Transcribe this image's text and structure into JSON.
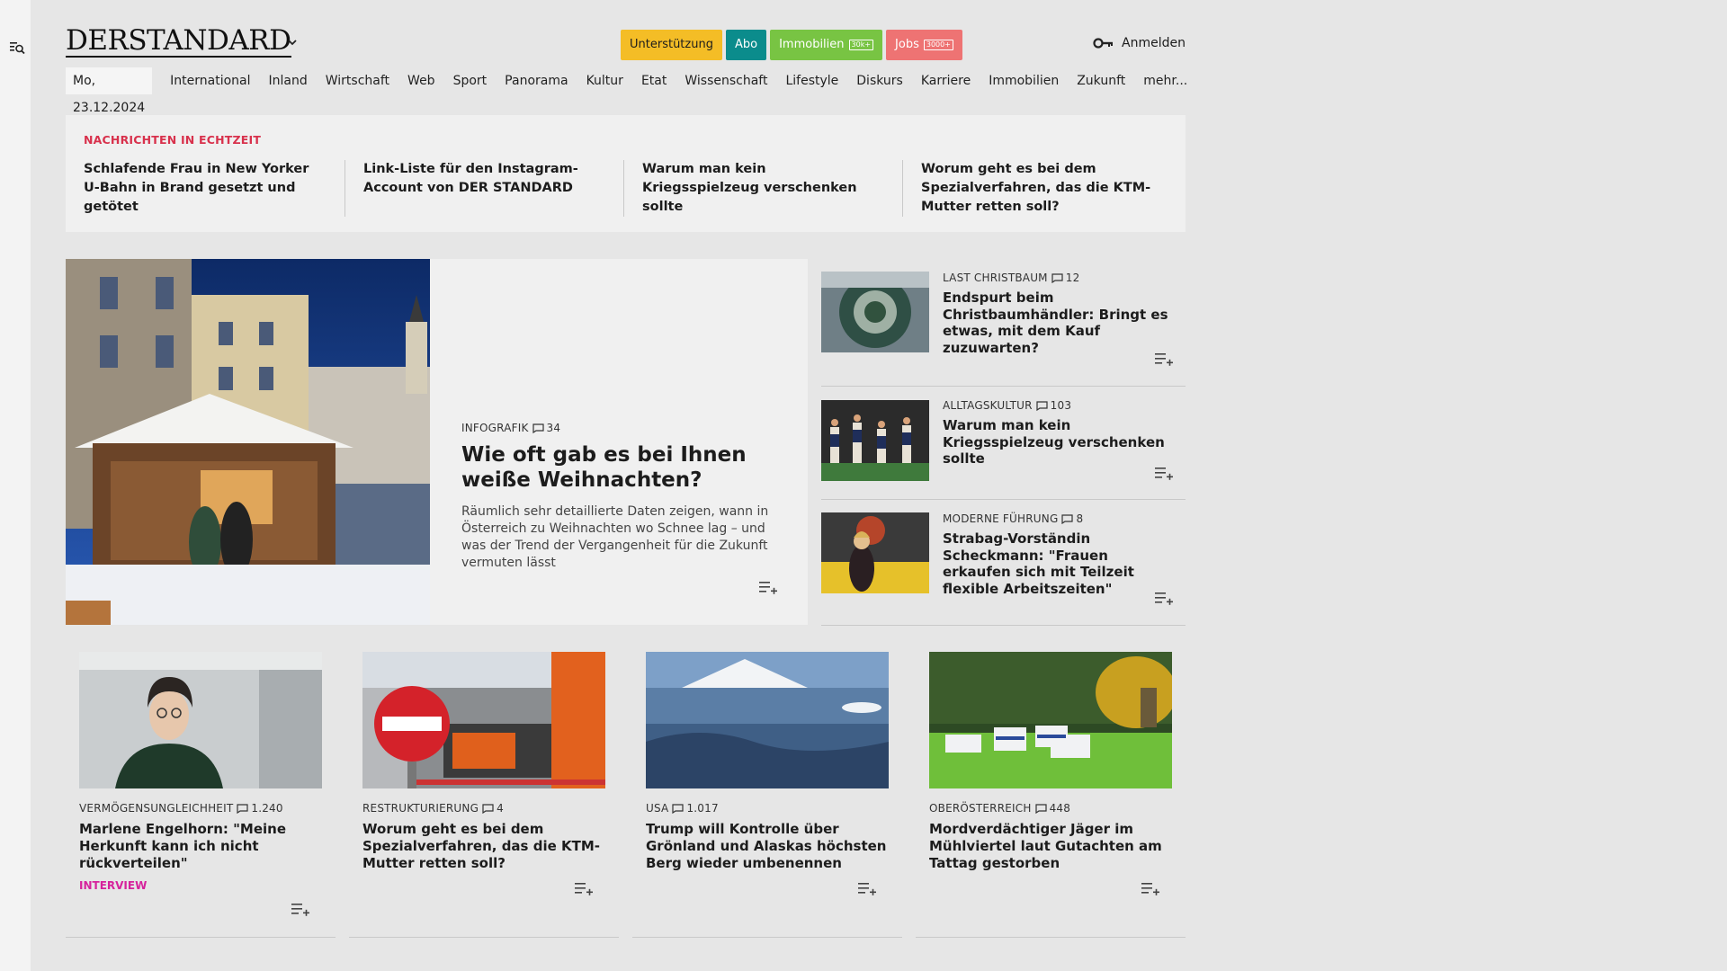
{
  "header": {
    "logo": "DERSTANDARD",
    "pills": {
      "support": "Unterstützung",
      "abo": "Abo",
      "immo": "Immobilien",
      "immo_badge": "30k+",
      "jobs": "Jobs",
      "jobs_badge": "3000+"
    },
    "login": "Anmelden"
  },
  "nav": {
    "date": "Mo, 23.12.2024",
    "items": [
      "International",
      "Inland",
      "Wirtschaft",
      "Web",
      "Sport",
      "Panorama",
      "Kultur",
      "Etat",
      "Wissenschaft",
      "Lifestyle",
      "Diskurs",
      "Karriere",
      "Immobilien",
      "Zukunft",
      "mehr..."
    ]
  },
  "ticker": {
    "label": "NACHRICHTEN IN ECHTZEIT",
    "items": [
      "Schlafende Frau in New Yorker U-Bahn in Brand gesetzt und getötet",
      "Link-Liste für den Instagram-Account von DER STANDARD",
      "Warum man kein Kriegsspielzeug verschenken sollte",
      "Worum geht es bei dem Spezialverfahren, das die KTM-Mutter retten soll?"
    ]
  },
  "hero": {
    "kicker": "INFOGRAFIK",
    "comments": "34",
    "title": "Wie oft gab es bei Ihnen weiße Weihnachten?",
    "lead": "Räumlich sehr detaillierte Daten zeigen, wann in Österreich zu Weihnachten wo Schnee lag – und was der Trend der Vergangenheit für die Zukunft vermuten lässt"
  },
  "side": [
    {
      "kicker": "LAST CHRISTBAUM",
      "comments": "12",
      "title": "Endspurt beim Christbaumhändler: Bringt es etwas, mit dem Kauf zuzuwarten?"
    },
    {
      "kicker": "ALLTAGSKULTUR",
      "comments": "103",
      "title": "Warum man kein Kriegsspielzeug verschenken sollte"
    },
    {
      "kicker": "MODERNE FÜHRUNG",
      "comments": "8",
      "title": "Strabag-Vorständin Scheckmann: \"Frauen erkaufen sich mit Teilzeit flexible Arbeitszeiten\""
    }
  ],
  "cards": [
    {
      "kicker": "VERMÖGENSUNGLEICHHEIT",
      "comments": "1.240",
      "title": "Marlene Engelhorn: \"Meine Herkunft kann ich nicht rückverteilen\"",
      "tag": "INTERVIEW"
    },
    {
      "kicker": "RESTRUKTURIERUNG",
      "comments": "4",
      "title": "Worum geht es bei dem Spezialverfahren, das die KTM-Mutter retten soll?"
    },
    {
      "kicker": "USA",
      "comments": "1.017",
      "title": "Trump will Kontrolle über Grönland und Alaskas höchsten Berg wieder umbenennen"
    },
    {
      "kicker": "OBERÖSTERREICH",
      "comments": "448",
      "title": "Mordverdächtiger Jäger im Mühlviertel laut Gutachten am Tattag gestorben"
    }
  ],
  "colors": {
    "support": "#f4bd26",
    "abo": "#0b8c8c",
    "immo": "#78c443",
    "jobs": "#ee7373",
    "live": "#d8314c",
    "tag": "#d6229c"
  }
}
